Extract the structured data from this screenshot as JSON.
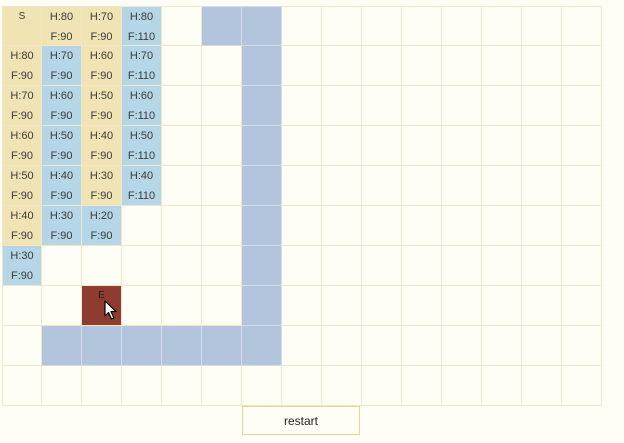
{
  "grid": {
    "rows": 10,
    "cols": 15,
    "start_label": "S",
    "end_label": "E",
    "start": [
      0,
      0
    ],
    "end": [
      7,
      2
    ],
    "walls": [
      [
        0,
        5
      ],
      [
        0,
        6
      ],
      [
        1,
        6
      ],
      [
        2,
        6
      ],
      [
        3,
        6
      ],
      [
        4,
        6
      ],
      [
        5,
        6
      ],
      [
        6,
        6
      ],
      [
        7,
        6
      ],
      [
        8,
        1
      ],
      [
        8,
        2
      ],
      [
        8,
        3
      ],
      [
        8,
        4
      ],
      [
        8,
        5
      ],
      [
        8,
        6
      ]
    ],
    "closed": [
      [
        1,
        0
      ],
      [
        2,
        0
      ],
      [
        3,
        0
      ],
      [
        4,
        0
      ],
      [
        5,
        0
      ],
      [
        0,
        1
      ],
      [
        0,
        2
      ],
      [
        1,
        2
      ],
      [
        2,
        2
      ],
      [
        3,
        2
      ],
      [
        4,
        2
      ]
    ],
    "open": [
      [
        0,
        3
      ],
      [
        1,
        1
      ],
      [
        2,
        1
      ],
      [
        3,
        1
      ],
      [
        4,
        1
      ],
      [
        5,
        1
      ],
      [
        1,
        3
      ],
      [
        2,
        3
      ],
      [
        3,
        3
      ],
      [
        4,
        3
      ],
      [
        5,
        2
      ],
      [
        6,
        0
      ]
    ],
    "scores": {
      "0,1": {
        "h": "H:80",
        "f": "F:90"
      },
      "0,2": {
        "h": "H:70",
        "f": "F:90"
      },
      "0,3": {
        "h": "H:80",
        "f": "F:110"
      },
      "1,0": {
        "h": "H:80",
        "f": "F:90"
      },
      "1,1": {
        "h": "H:70",
        "f": "F:90"
      },
      "1,2": {
        "h": "H:60",
        "f": "F:90"
      },
      "1,3": {
        "h": "H:70",
        "f": "F:110"
      },
      "2,0": {
        "h": "H:70",
        "f": "F:90"
      },
      "2,1": {
        "h": "H:60",
        "f": "F:90"
      },
      "2,2": {
        "h": "H:50",
        "f": "F:90"
      },
      "2,3": {
        "h": "H:60",
        "f": "F:110"
      },
      "3,0": {
        "h": "H:60",
        "f": "F:90"
      },
      "3,1": {
        "h": "H:50",
        "f": "F:90"
      },
      "3,2": {
        "h": "H:40",
        "f": "F:90"
      },
      "3,3": {
        "h": "H:50",
        "f": "F:110"
      },
      "4,0": {
        "h": "H:50",
        "f": "F:90"
      },
      "4,1": {
        "h": "H:40",
        "f": "F:90"
      },
      "4,2": {
        "h": "H:30",
        "f": "F:90"
      },
      "4,3": {
        "h": "H:40",
        "f": "F:110"
      },
      "5,0": {
        "h": "H:40",
        "f": "F:90"
      },
      "5,1": {
        "h": "H:30",
        "f": "F:90"
      },
      "5,2": {
        "h": "H:20",
        "f": "F:90"
      },
      "6,0": {
        "h": "H:30",
        "f": "F:90"
      }
    }
  },
  "colors": {
    "closed": "#f0e4b5",
    "open": "#b5d6e6",
    "wall": "#b3c4dd",
    "end": "#8e3b30",
    "background": "#fffef6"
  },
  "controls": {
    "restart_label": "restart"
  },
  "cursor": {
    "icon": "arrow-cursor-icon"
  }
}
